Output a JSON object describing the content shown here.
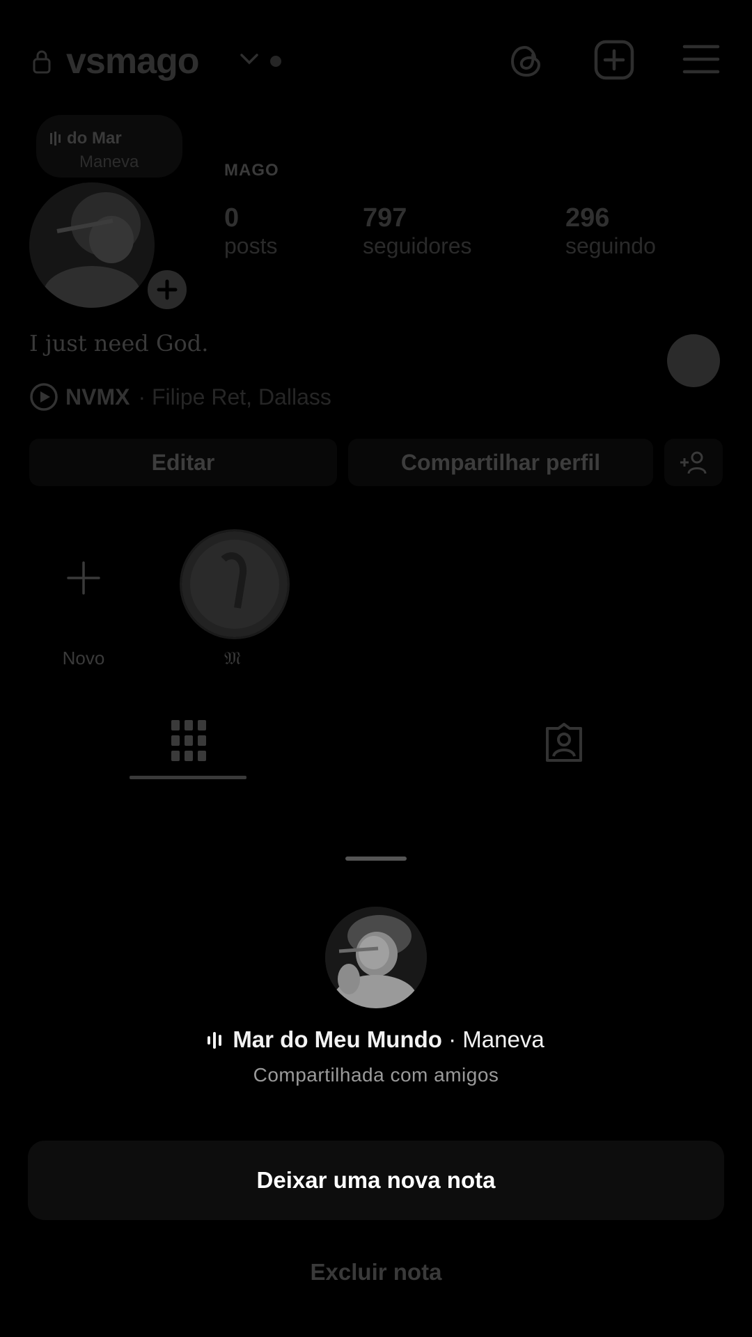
{
  "profile": {
    "username": "vsmago",
    "display_name": "MAGO",
    "stats": [
      {
        "value": "0",
        "label": "posts"
      },
      {
        "value": "797",
        "label": "seguidores"
      },
      {
        "value": "296",
        "label": "seguindo"
      }
    ],
    "bio": "I just need God.",
    "music": {
      "song": "NVMX",
      "artist": "· Filipe Ret, Dallass"
    },
    "note_bubble": {
      "line1": "do  Mar",
      "line2": "Maneva"
    },
    "buttons": {
      "edit": "Editar",
      "share": "Compartilhar perfil"
    },
    "highlights": [
      {
        "label": "Novo"
      },
      {
        "label": "𝔐"
      }
    ]
  },
  "sheet": {
    "song_title": "Mar do Meu Mundo",
    "song_artist": " · Maneva",
    "subtitle": "Compartilhada com amigos",
    "primary_action": "Deixar uma nova nota",
    "delete_action": "Excluir nota"
  },
  "icons": {
    "lock": "lock-icon",
    "dropdown": "chevron-down-icon",
    "threads": "threads-icon",
    "new_post": "add-square-icon",
    "menu": "hamburger-menu-icon",
    "play": "play-circle-icon",
    "add_person": "add-person-icon",
    "grid": "grid-icon",
    "tagged": "tagged-person-icon",
    "audio": "audio-bars-icon"
  }
}
